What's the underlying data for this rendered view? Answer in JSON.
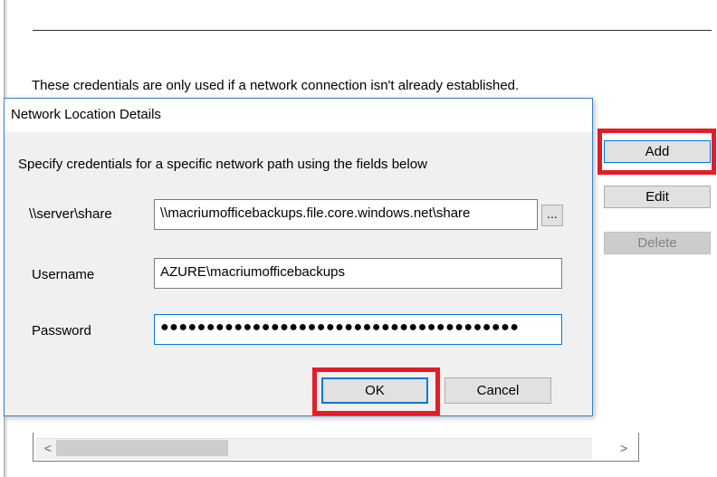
{
  "page": {
    "note": "These credentials are only used if a network connection isn't already established."
  },
  "side_buttons": {
    "add": "Add",
    "edit": "Edit",
    "delete": "Delete"
  },
  "dialog": {
    "title": "Network Location Details",
    "instruction": "Specify credentials for a specific network path using the fields below",
    "share_label": "\\\\server\\share",
    "share_value": "\\\\macriumofficebackups.file.core.windows.net\\share",
    "browse_label": "...",
    "username_label": "Username",
    "username_value": "AZURE\\macriumofficebackups",
    "password_label": "Password",
    "password_value": "●●●●●●●●●●●●●●●●●●●●●●●●●●●●●●●●●●●●●●●",
    "ok": "OK",
    "cancel": "Cancel"
  },
  "scrollbar": {
    "left_arrow": "<",
    "right_arrow": ">"
  },
  "colors": {
    "highlight": "#e41c2a",
    "focus": "#0078d7"
  }
}
